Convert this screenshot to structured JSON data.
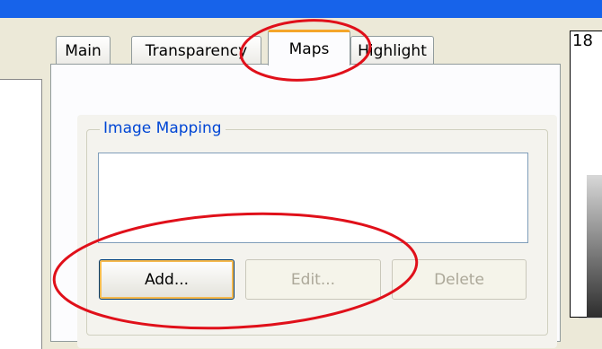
{
  "tabs": [
    {
      "label": "Main",
      "active": false
    },
    {
      "label": "Transparency",
      "active": false
    },
    {
      "label": "Maps",
      "active": true
    },
    {
      "label": "Highlight",
      "active": false
    }
  ],
  "group": {
    "title": "Image Mapping"
  },
  "buttons": {
    "add": "Add...",
    "edit": "Edit...",
    "delete": "Delete"
  },
  "right_panel": {
    "number": "18"
  },
  "colors": {
    "titlebar": "#1763ea",
    "annotation": "#e0101a",
    "group_title": "#0046d5",
    "active_tab_accent": "#f4a52a"
  }
}
